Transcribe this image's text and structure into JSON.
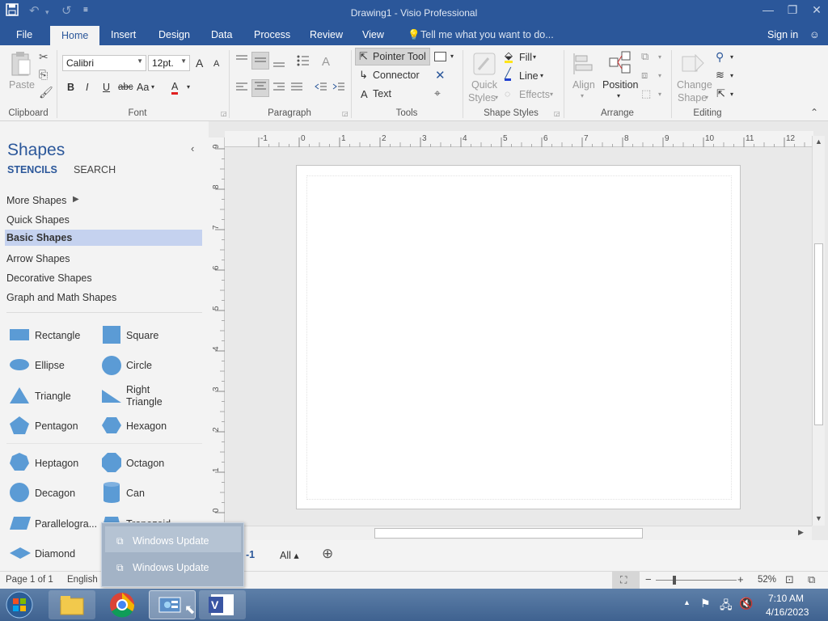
{
  "window": {
    "title": "Drawing1 - Visio Professional",
    "signin": "Sign in",
    "undo_glyph": "↶",
    "redo_glyph": "↺",
    "save_glyph": "💾"
  },
  "tabs": {
    "file": "File",
    "home": "Home",
    "insert": "Insert",
    "design": "Design",
    "data": "Data",
    "process": "Process",
    "review": "Review",
    "view": "View",
    "tell_me": "Tell me what you want to do..."
  },
  "ribbon": {
    "clipboard": {
      "label": "Clipboard",
      "paste": "Paste"
    },
    "font": {
      "label": "Font",
      "family": "Calibri",
      "size": "12pt.",
      "bold": "B",
      "italic": "I",
      "underline": "U",
      "strike": "abc",
      "case": "Aa",
      "grow": "A",
      "shrink": "A",
      "color": "A"
    },
    "paragraph": {
      "label": "Paragraph"
    },
    "tools": {
      "label": "Tools",
      "pointer": "Pointer Tool",
      "connector": "Connector",
      "text": "Text",
      "text_glyph": "A"
    },
    "shape_styles": {
      "label": "Shape Styles",
      "quick": "Quick",
      "styles": "Styles",
      "fill": "Fill",
      "line": "Line",
      "effects": "Effects"
    },
    "arrange": {
      "label": "Arrange",
      "align": "Align",
      "position": "Position"
    },
    "editing": {
      "label": "Editing",
      "change": "Change",
      "shape": "Shape"
    }
  },
  "shapes_pane": {
    "title": "Shapes",
    "tab_stencils": "STENCILS",
    "tab_search": "SEARCH",
    "categories": [
      "More Shapes",
      "Quick Shapes",
      "Basic Shapes",
      "Arrow Shapes",
      "Decorative Shapes",
      "Graph and Math Shapes"
    ],
    "shapes": [
      "Rectangle",
      "Square",
      "Ellipse",
      "Circle",
      "Triangle",
      "Right Triangle",
      "Pentagon",
      "Hexagon",
      "Heptagon",
      "Octagon",
      "Decagon",
      "Can",
      "Parallelogra...",
      "Trapezoid",
      "Diamond"
    ]
  },
  "rulers": {
    "h": [
      "-1",
      "0",
      "1",
      "2",
      "3",
      "4",
      "5",
      "6",
      "7",
      "8",
      "9",
      "10",
      "11",
      "12"
    ],
    "v": [
      "9",
      "8",
      "7",
      "6",
      "5",
      "4",
      "3",
      "2",
      "1",
      "0"
    ]
  },
  "page_tabs": {
    "page_fragment": "-1",
    "all": "All ▴",
    "add": "⊕"
  },
  "status": {
    "page": "Page 1 of 1",
    "language": "English",
    "zoom": "52%"
  },
  "popup": {
    "items": [
      "Windows Update",
      "Windows Update"
    ]
  },
  "taskbar": {
    "time": "7:10 AM",
    "date": "4/16/2023"
  },
  "colors": {
    "accent": "#2b579a",
    "shape_fill": "#5b9bd5"
  }
}
